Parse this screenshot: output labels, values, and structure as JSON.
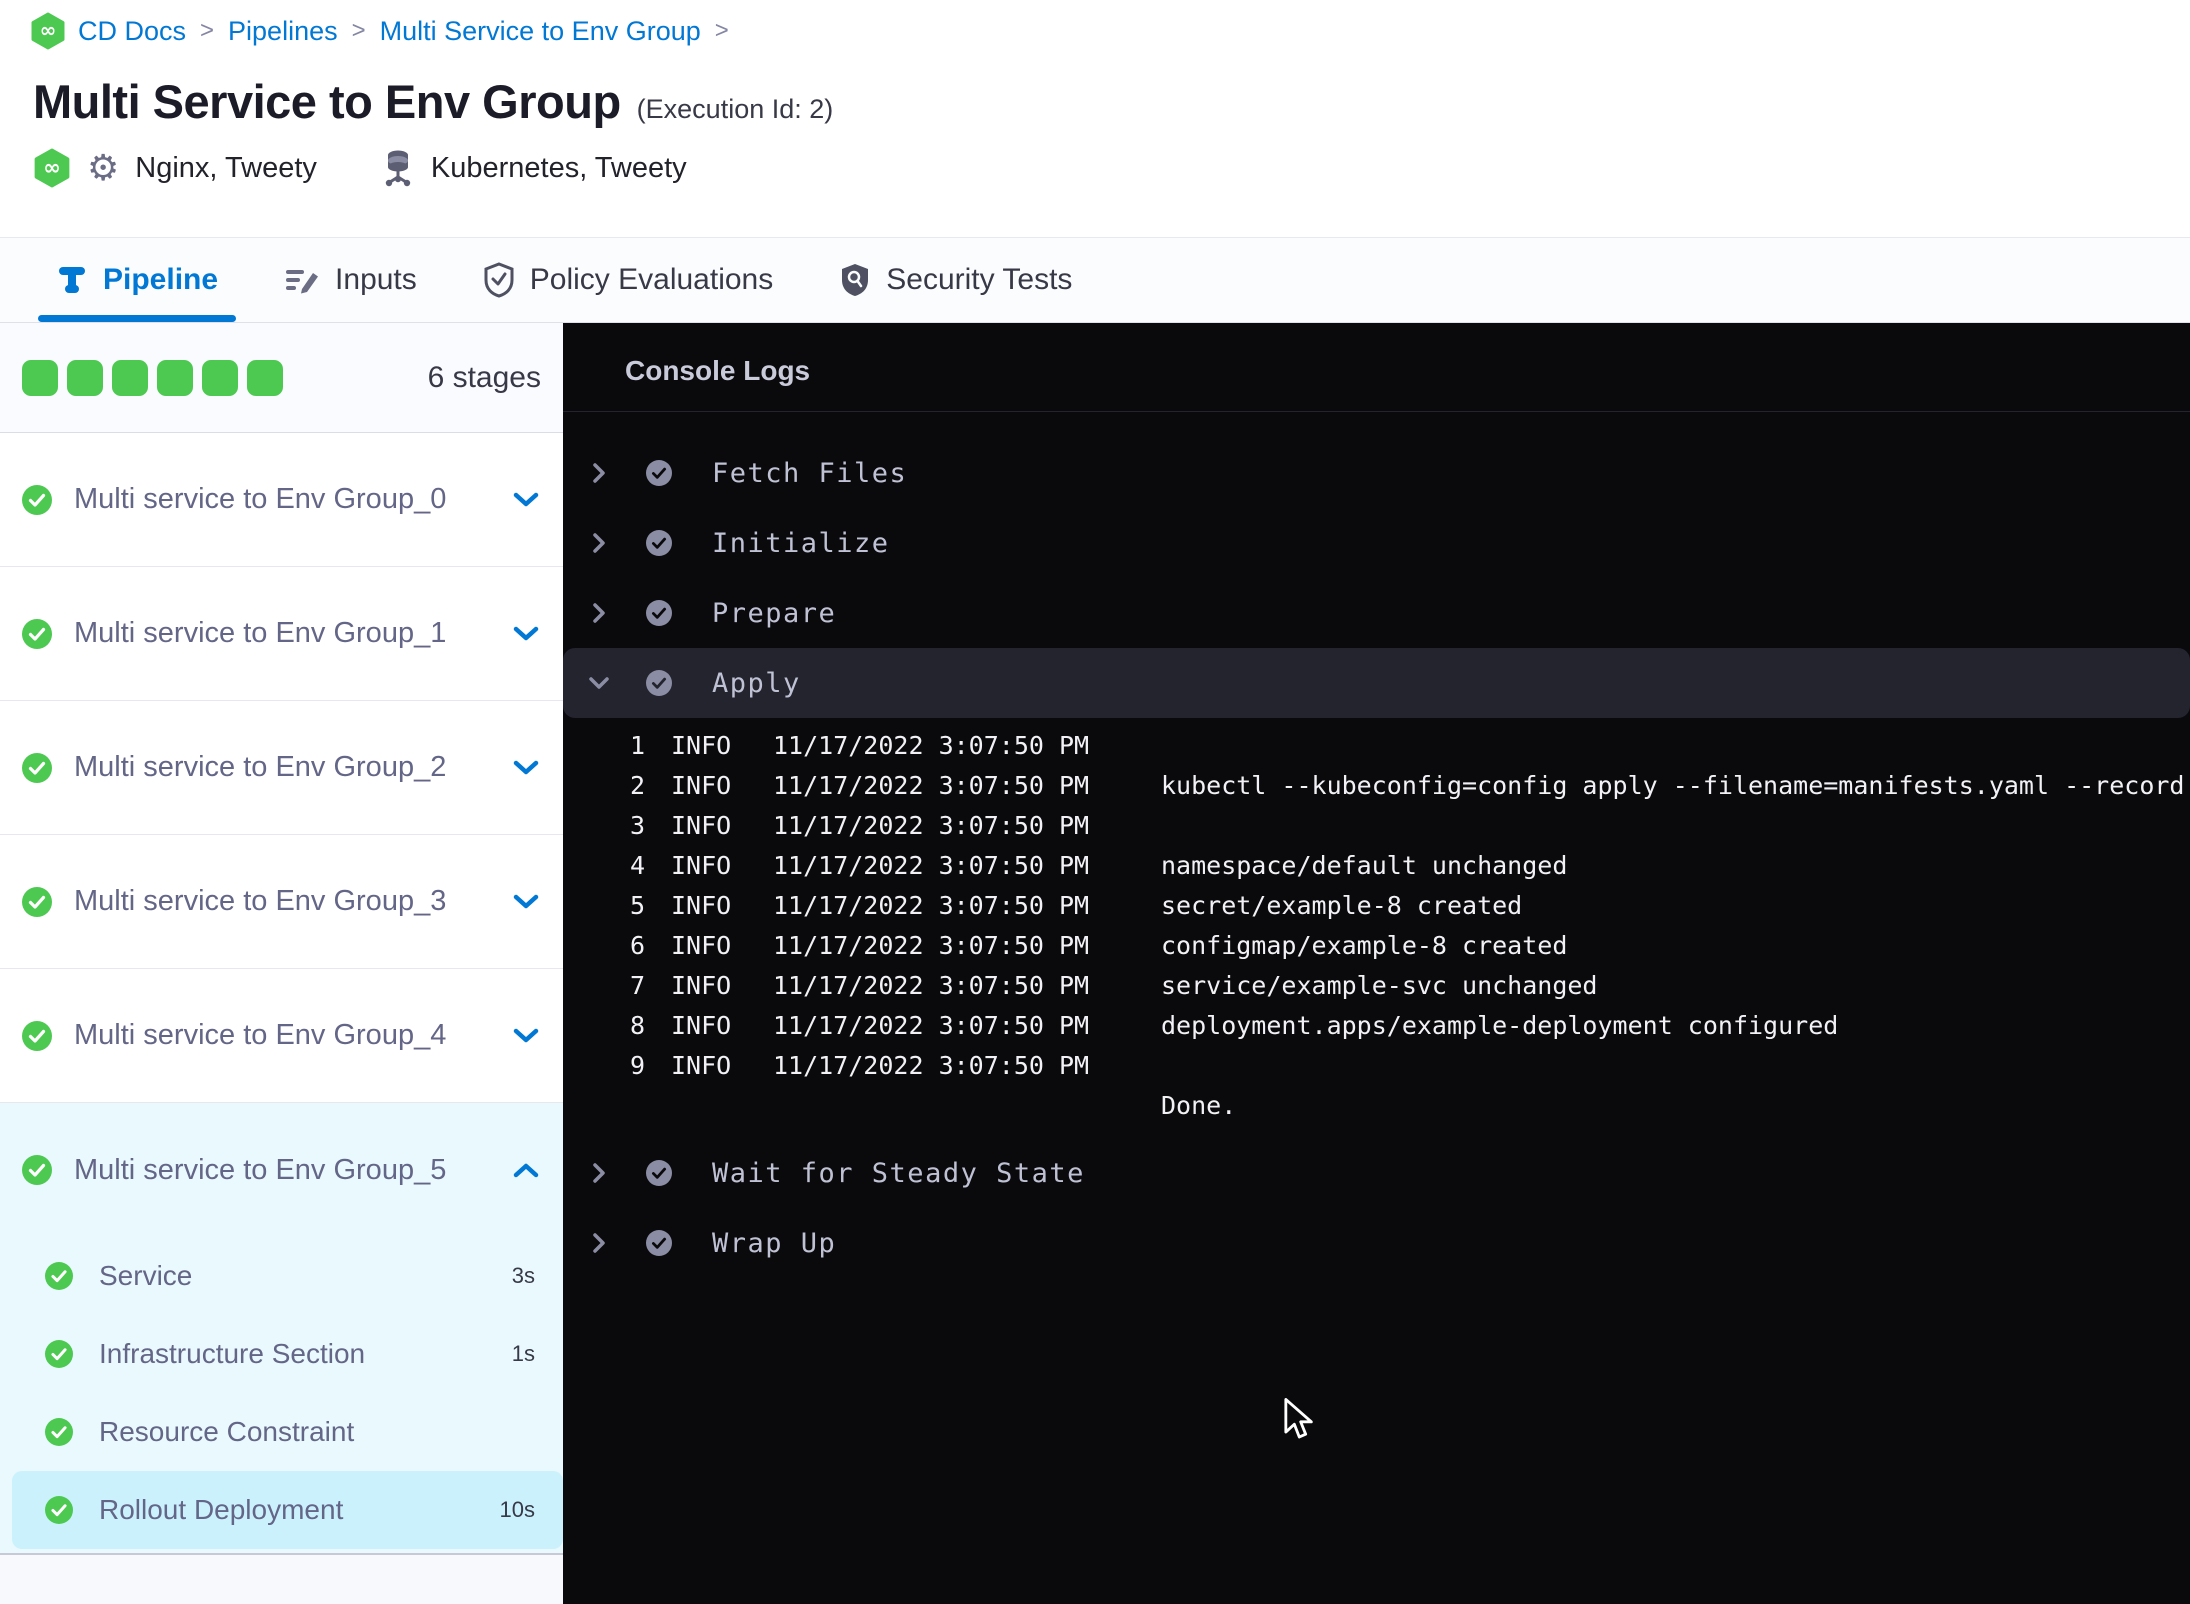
{
  "breadcrumb": {
    "items": [
      "CD Docs",
      "Pipelines",
      "Multi Service to Env Group"
    ],
    "separator": ">"
  },
  "header": {
    "title": "Multi Service to Env Group",
    "execution_id": "(Execution Id: 2)",
    "services_label": "Nginx, Tweety",
    "environment_label": "Kubernetes, Tweety"
  },
  "tabs": [
    {
      "label": "Pipeline",
      "icon": "pipeline-icon",
      "active": true
    },
    {
      "label": "Inputs",
      "icon": "inputs-icon",
      "active": false
    },
    {
      "label": "Policy Evaluations",
      "icon": "shield-check-icon",
      "active": false
    },
    {
      "label": "Security Tests",
      "icon": "shield-search-icon",
      "active": false
    }
  ],
  "sidebar": {
    "stage_count": "6 stages",
    "stages": [
      {
        "label": "Multi service to Env Group_0",
        "status": "success",
        "expanded": false
      },
      {
        "label": "Multi service to Env Group_1",
        "status": "success",
        "expanded": false
      },
      {
        "label": "Multi service to Env Group_2",
        "status": "success",
        "expanded": false
      },
      {
        "label": "Multi service to Env Group_3",
        "status": "success",
        "expanded": false
      },
      {
        "label": "Multi service to Env Group_4",
        "status": "success",
        "expanded": false
      },
      {
        "label": "Multi service to Env Group_5",
        "status": "success",
        "expanded": true
      }
    ],
    "steps": [
      {
        "label": "Service",
        "duration": "3s",
        "status": "success",
        "selected": false
      },
      {
        "label": "Infrastructure Section",
        "duration": "1s",
        "status": "success",
        "selected": false
      },
      {
        "label": "Resource Constraint",
        "duration": "",
        "status": "success",
        "selected": false
      },
      {
        "label": "Rollout Deployment",
        "duration": "10s",
        "status": "success",
        "selected": true
      }
    ]
  },
  "console": {
    "title": "Console Logs",
    "sections": [
      {
        "label": "Fetch Files",
        "status": "success",
        "expanded": false
      },
      {
        "label": "Initialize",
        "status": "success",
        "expanded": false
      },
      {
        "label": "Prepare",
        "status": "success",
        "expanded": false
      },
      {
        "label": "Apply",
        "status": "success",
        "expanded": true,
        "logs": [
          {
            "num": "1",
            "level": "INFO",
            "time": "11/17/2022 3:07:50 PM",
            "message": ""
          },
          {
            "num": "2",
            "level": "INFO",
            "time": "11/17/2022 3:07:50 PM",
            "message": "kubectl --kubeconfig=config apply --filename=manifests.yaml --record"
          },
          {
            "num": "3",
            "level": "INFO",
            "time": "11/17/2022 3:07:50 PM",
            "message": ""
          },
          {
            "num": "4",
            "level": "INFO",
            "time": "11/17/2022 3:07:50 PM",
            "message": "namespace/default unchanged"
          },
          {
            "num": "5",
            "level": "INFO",
            "time": "11/17/2022 3:07:50 PM",
            "message": "secret/example-8 created"
          },
          {
            "num": "6",
            "level": "INFO",
            "time": "11/17/2022 3:07:50 PM",
            "message": "configmap/example-8 created"
          },
          {
            "num": "7",
            "level": "INFO",
            "time": "11/17/2022 3:07:50 PM",
            "message": "service/example-svc unchanged"
          },
          {
            "num": "8",
            "level": "INFO",
            "time": "11/17/2022 3:07:50 PM",
            "message": "deployment.apps/example-deployment configured"
          },
          {
            "num": "9",
            "level": "INFO",
            "time": "11/17/2022 3:07:50 PM",
            "message": ""
          },
          {
            "num": "",
            "level": "",
            "time": "",
            "message": "Done."
          }
        ]
      },
      {
        "label": "Wait for Steady State",
        "status": "success",
        "expanded": false
      },
      {
        "label": "Wrap Up",
        "status": "success",
        "expanded": false
      }
    ]
  },
  "colors": {
    "accent_blue": "#0278d5",
    "success_green": "#4dc952",
    "title_text": "#1c1c28",
    "muted_text": "#646687",
    "console_bg": "#0a0a0d",
    "console_band": "#23242e",
    "selected_step_bg": "#cbf1fd",
    "expanded_group_bg": "#e9f9fe"
  }
}
